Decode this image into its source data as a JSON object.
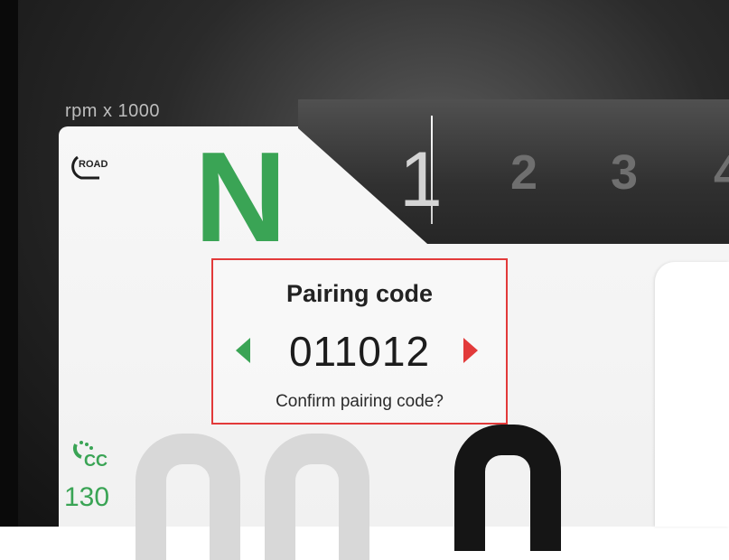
{
  "dashboard": {
    "rpm_label": "rpm x 1000",
    "ride_mode": "ROAD",
    "gear": "N",
    "gear_color": "#3aa455",
    "tach_numbers": [
      "1",
      "2",
      "3",
      "4"
    ],
    "cruise_control": {
      "label": "CC",
      "speed": "130",
      "icon": "cruise-control-icon",
      "color": "#3aa455"
    }
  },
  "dialog": {
    "title": "Pairing code",
    "code": "011012",
    "prompt": "Confirm pairing code?",
    "left_arrow": "arrow-left-icon",
    "right_arrow": "arrow-right-icon",
    "border_color": "#e23a3a"
  }
}
